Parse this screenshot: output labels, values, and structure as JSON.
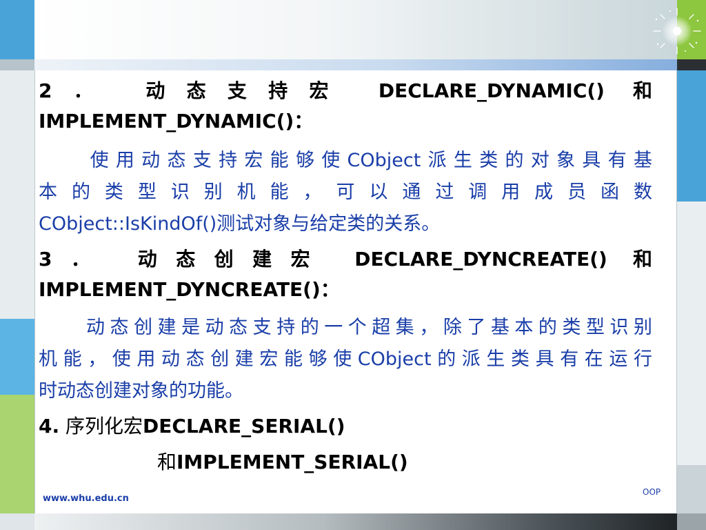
{
  "slide": {
    "heading2": {
      "line1_prefix": "2．　动态支持宏",
      "line1_macro": "DECLARE_DYNAMIC()",
      "line1_suffix": "和",
      "line2": "IMPLEMENT_DYNAMIC()：",
      "body": [
        "　　使用动态支持宏能够使CObject派生类的对象具有基",
        "本的类型识别机能，可以通过调用成员函数",
        "CObject::IsKindOf()测试对象与给定类的关系。"
      ]
    },
    "heading3": {
      "line1_prefix": "3．　动态创建宏",
      "line1_macro": "DECLARE_DYNCREATE()",
      "line1_suffix": "和",
      "line2": "IMPLEMENT_DYNCREATE()：",
      "body": [
        "　　动态创建是动态支持的一个超集，除了基本的类型识别",
        "机能，使用动态创建宏能够使CObject的派生类具有在运行",
        "时动态创建对象的功能。"
      ]
    },
    "heading4": {
      "line1_prefix": "4.",
      "line1_text": "序列化宏",
      "line1_macro": "DECLARE_SERIAL()",
      "line2_prefix": "和",
      "line2_macro": "IMPLEMENT_SERIAL()"
    }
  },
  "footer": {
    "url": "www.whu.edu.cn",
    "label": "OOP"
  },
  "colors": {
    "body_text": "#1a3ea8",
    "heading_text": "#000000",
    "accent_green": "#8dc63f",
    "accent_blue": "#4aa3d8"
  }
}
